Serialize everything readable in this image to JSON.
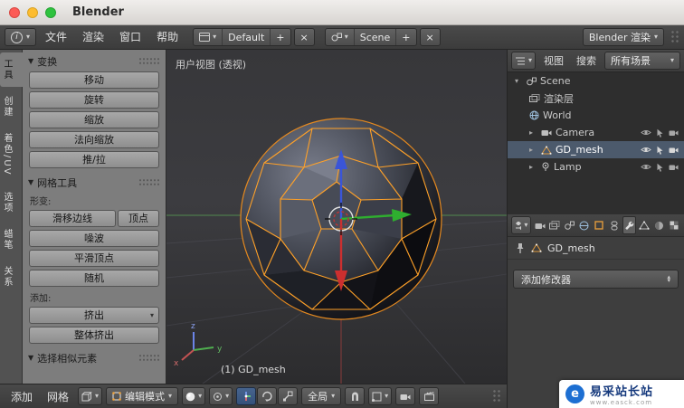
{
  "icons": {
    "info": "i",
    "caret_down": "▾",
    "caret_up": "▴",
    "plus": "+",
    "close": "×",
    "panel_open": "▼",
    "tree_open": "▾",
    "tree_closed": "▸"
  },
  "window": {
    "title": "Blender"
  },
  "menubar": {
    "menus": [
      "文件",
      "渲染",
      "窗口",
      "帮助"
    ],
    "layout_name": "Default",
    "scene_name": "Scene",
    "engine_name": "Blender 渲染"
  },
  "toolshelf": {
    "tabs": [
      "工具",
      "创建",
      "着色/UV",
      "选项",
      "蜡笔",
      "关系"
    ],
    "transform": {
      "title": "变换",
      "buttons": [
        "移动",
        "旋转",
        "缩放",
        "法向缩放",
        "推/拉"
      ]
    },
    "mesh_tools": {
      "title": "网格工具",
      "deform_label": "形变:",
      "edge_slide": "滑移边线",
      "vertex_slide": "顶点",
      "noise": "噪波",
      "smooth_vertex": "平滑顶点",
      "randomize": "随机",
      "add_label": "添加:",
      "extrude": "挤出",
      "extrude_individual": "整体挤出"
    },
    "select_similar": {
      "title": "选择相似元素"
    }
  },
  "viewport": {
    "view_label": "用户视图 (透视)",
    "object_info": "(1) GD_mesh",
    "axis": {
      "x": "x",
      "y": "y",
      "z": "z"
    }
  },
  "outliner": {
    "view_menu": "视图",
    "search_menu": "搜索",
    "scope": "所有场景",
    "items": [
      {
        "label": "Scene"
      },
      {
        "label": "渲染层"
      },
      {
        "label": "World"
      },
      {
        "label": "Camera"
      },
      {
        "label": "GD_mesh"
      },
      {
        "label": "Lamp"
      }
    ]
  },
  "properties": {
    "object_name": "GD_mesh",
    "add_modifier_label": "添加修改器"
  },
  "bottom_bar": {
    "add_menu": "添加",
    "mesh_menu": "网格",
    "mode": "编辑模式",
    "orientation": "全局"
  },
  "watermark": {
    "title": "易采站长站",
    "subtitle": "www.easck.com"
  }
}
